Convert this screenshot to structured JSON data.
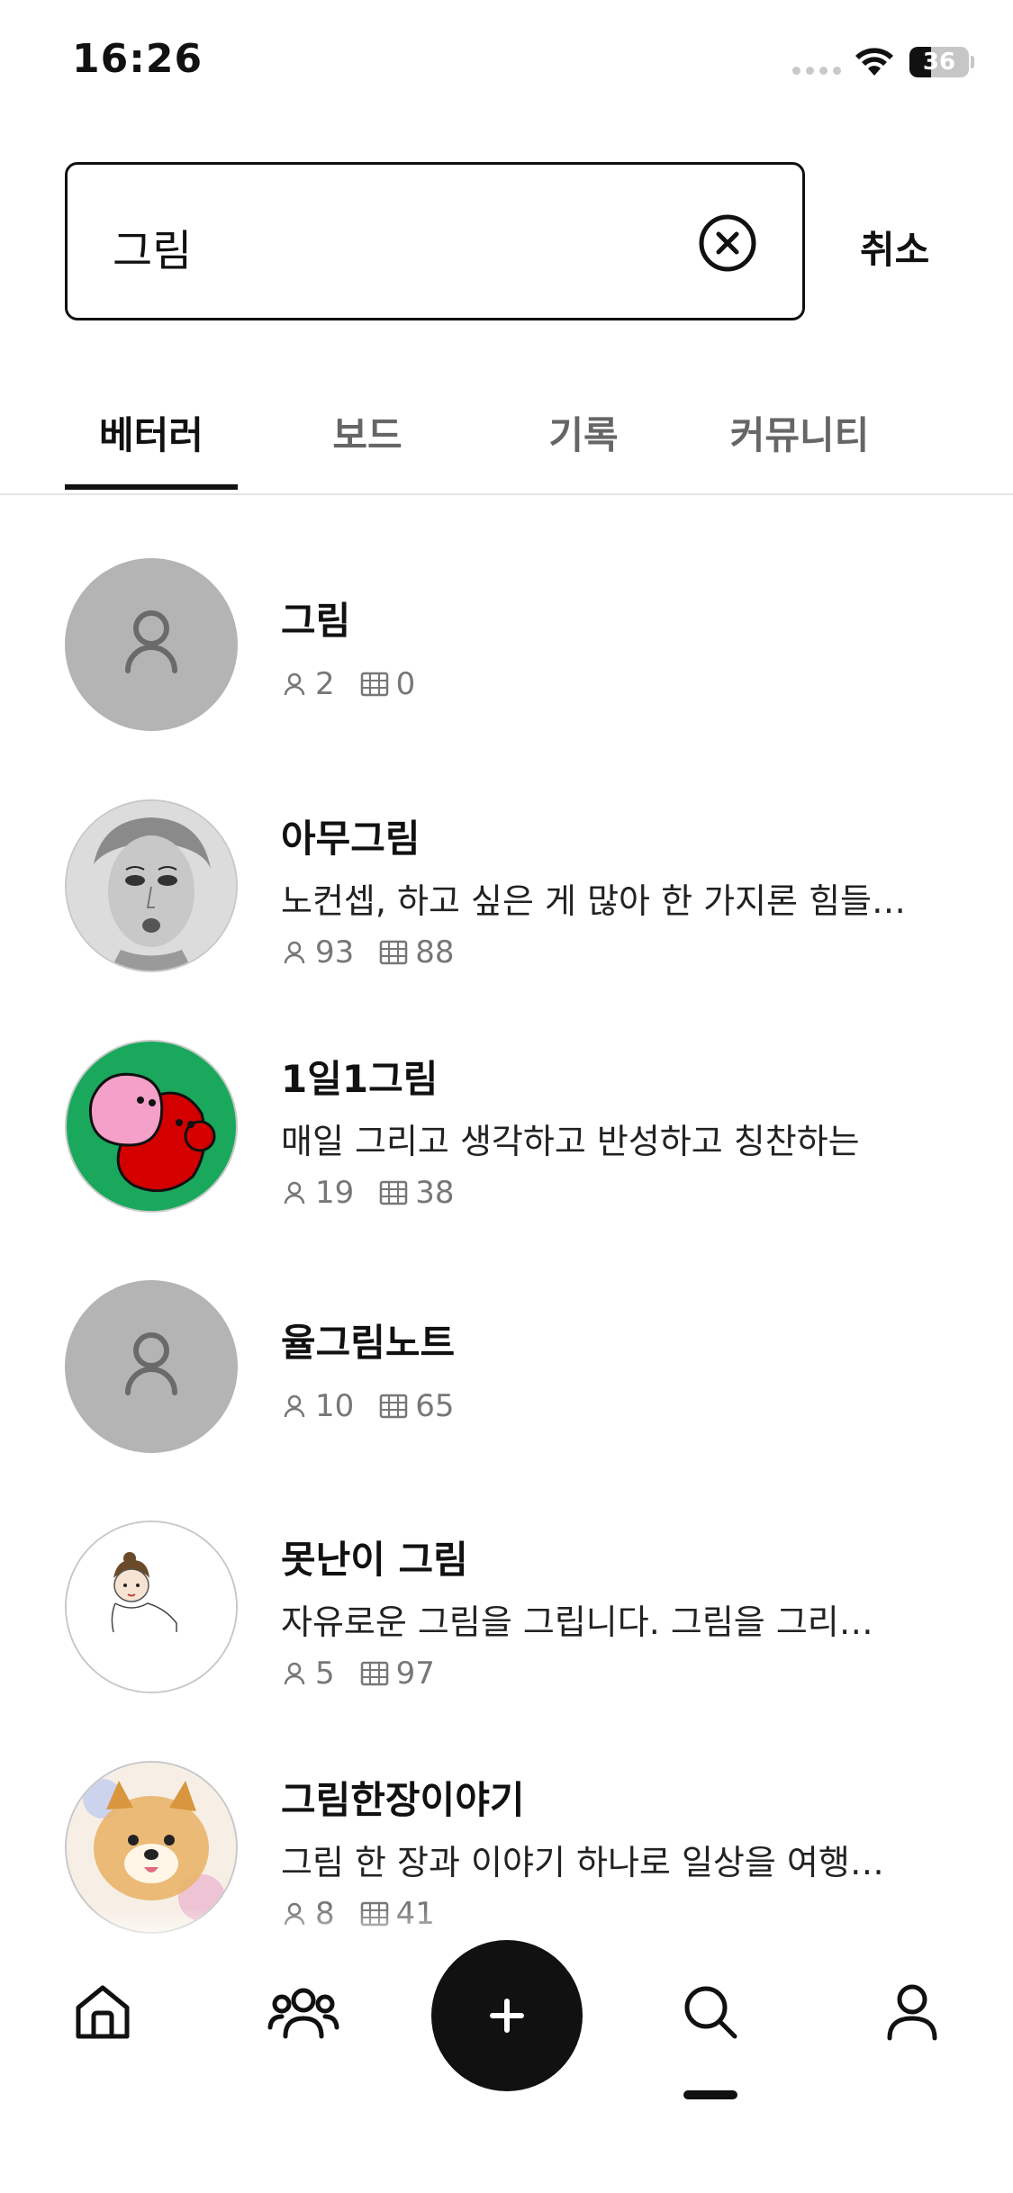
{
  "status_bar": {
    "time": "16:26",
    "battery": "36",
    "battery_level": 0.36
  },
  "search": {
    "value": "그림",
    "cancel_label": "취소"
  },
  "tabs": [
    {
      "label": "베터러",
      "active": true
    },
    {
      "label": "보드",
      "active": false
    },
    {
      "label": "기록",
      "active": false
    },
    {
      "label": "커뮤니티",
      "active": false
    }
  ],
  "results": [
    {
      "name": "그림",
      "desc": "",
      "followers": "2",
      "posts": "0",
      "avatar": "person-icon"
    },
    {
      "name": "아무그림",
      "desc": "노컨셉, 하고 싶은 게 많아 한 가지론 힘들…",
      "followers": "93",
      "posts": "88",
      "avatar": "portrait-sketch"
    },
    {
      "name": "1일1그림",
      "desc": "매일 그리고 생각하고 반성하고 칭찬하는",
      "followers": "19",
      "posts": "38",
      "avatar": "red-pink-characters"
    },
    {
      "name": "율그림노트",
      "desc": "",
      "followers": "10",
      "posts": "65",
      "avatar": "person-icon"
    },
    {
      "name": "못난이 그림",
      "desc": "자유로운 그림을 그립니다. 그림을 그리…",
      "followers": "5",
      "posts": "97",
      "avatar": "small-character-drawing"
    },
    {
      "name": "그림한장이야기",
      "desc": "그림 한 장과 이야기 하나로 일상을 여행…",
      "followers": "8",
      "posts": "41",
      "avatar": "watercolor-dog"
    }
  ],
  "bottom_nav": [
    {
      "icon": "home-icon"
    },
    {
      "icon": "community-icon"
    },
    {
      "icon": "plus-icon"
    },
    {
      "icon": "search-icon"
    },
    {
      "icon": "profile-icon"
    }
  ],
  "colors": {
    "accent": "#111111",
    "placeholder_avatar": "#b4b4b4",
    "muted_text": "#777777",
    "green_bg": "#1aa85c",
    "red": "#d40000",
    "pink": "#f4a0c8"
  }
}
